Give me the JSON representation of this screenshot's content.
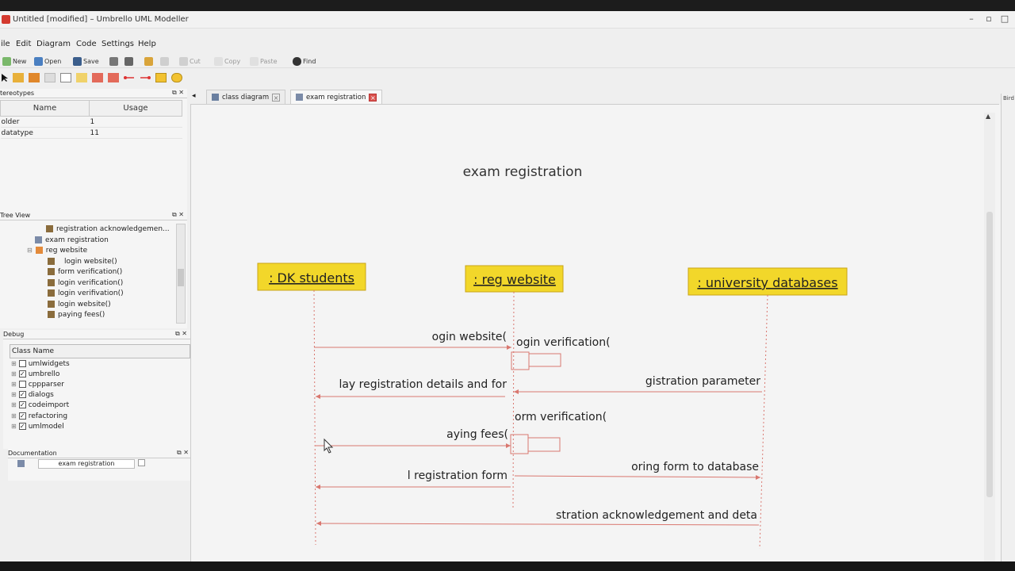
{
  "window": {
    "title": "Untitled [modified] – Umbrello UML Modeller"
  },
  "menu": [
    "ile",
    "Edit",
    "Diagram",
    "Code",
    "Settings",
    "Help"
  ],
  "toolbar": {
    "new": "New",
    "open": "Open",
    "save": "Save",
    "cut": "Cut",
    "copy": "Copy",
    "paste": "Paste",
    "find": "Find"
  },
  "stereotypes": {
    "title": "tereotypes",
    "columns": [
      "Name",
      "Usage"
    ],
    "rows": [
      {
        "name": "older",
        "usage": "1"
      },
      {
        "name": "datatype",
        "usage": "11"
      }
    ]
  },
  "tree_view": {
    "title": "Tree View",
    "items": [
      "registration acknowledgemen...",
      "exam registration",
      "reg website",
      "login website()",
      "form verification()",
      "login verification()",
      "login verifivation()",
      "login website()",
      "paying fees()"
    ]
  },
  "debug": {
    "title": "Debug",
    "column": "Class Name",
    "items": [
      {
        "label": "umlwidgets",
        "checked": false
      },
      {
        "label": "umbrello",
        "checked": true
      },
      {
        "label": "cppparser",
        "checked": false
      },
      {
        "label": "dialogs",
        "checked": true
      },
      {
        "label": "codeimport",
        "checked": true
      },
      {
        "label": "refactoring",
        "checked": true
      },
      {
        "label": "umlmodel",
        "checked": true
      }
    ]
  },
  "documentation": {
    "title": "Documentation",
    "value": "exam registration"
  },
  "tabs": [
    {
      "label": "class diagram",
      "active": false
    },
    {
      "label": "exam registration",
      "active": true
    }
  ],
  "right_panel_label": "Bird",
  "diagram": {
    "title": "exam registration",
    "lifelines": [
      ": DK students",
      ": reg website",
      ": university databases"
    ],
    "messages": [
      "ogin website(",
      "ogin verification(",
      "lay registration details and for",
      "gistration parameter",
      "orm verification(",
      "aying fees(",
      "oring form to database",
      "l registration form",
      "stration acknowledgement and deta"
    ]
  },
  "colors": {
    "lifeline_box": "#f2d72a",
    "message_line": "#d9776f",
    "canvas": "#f4f4f4"
  }
}
